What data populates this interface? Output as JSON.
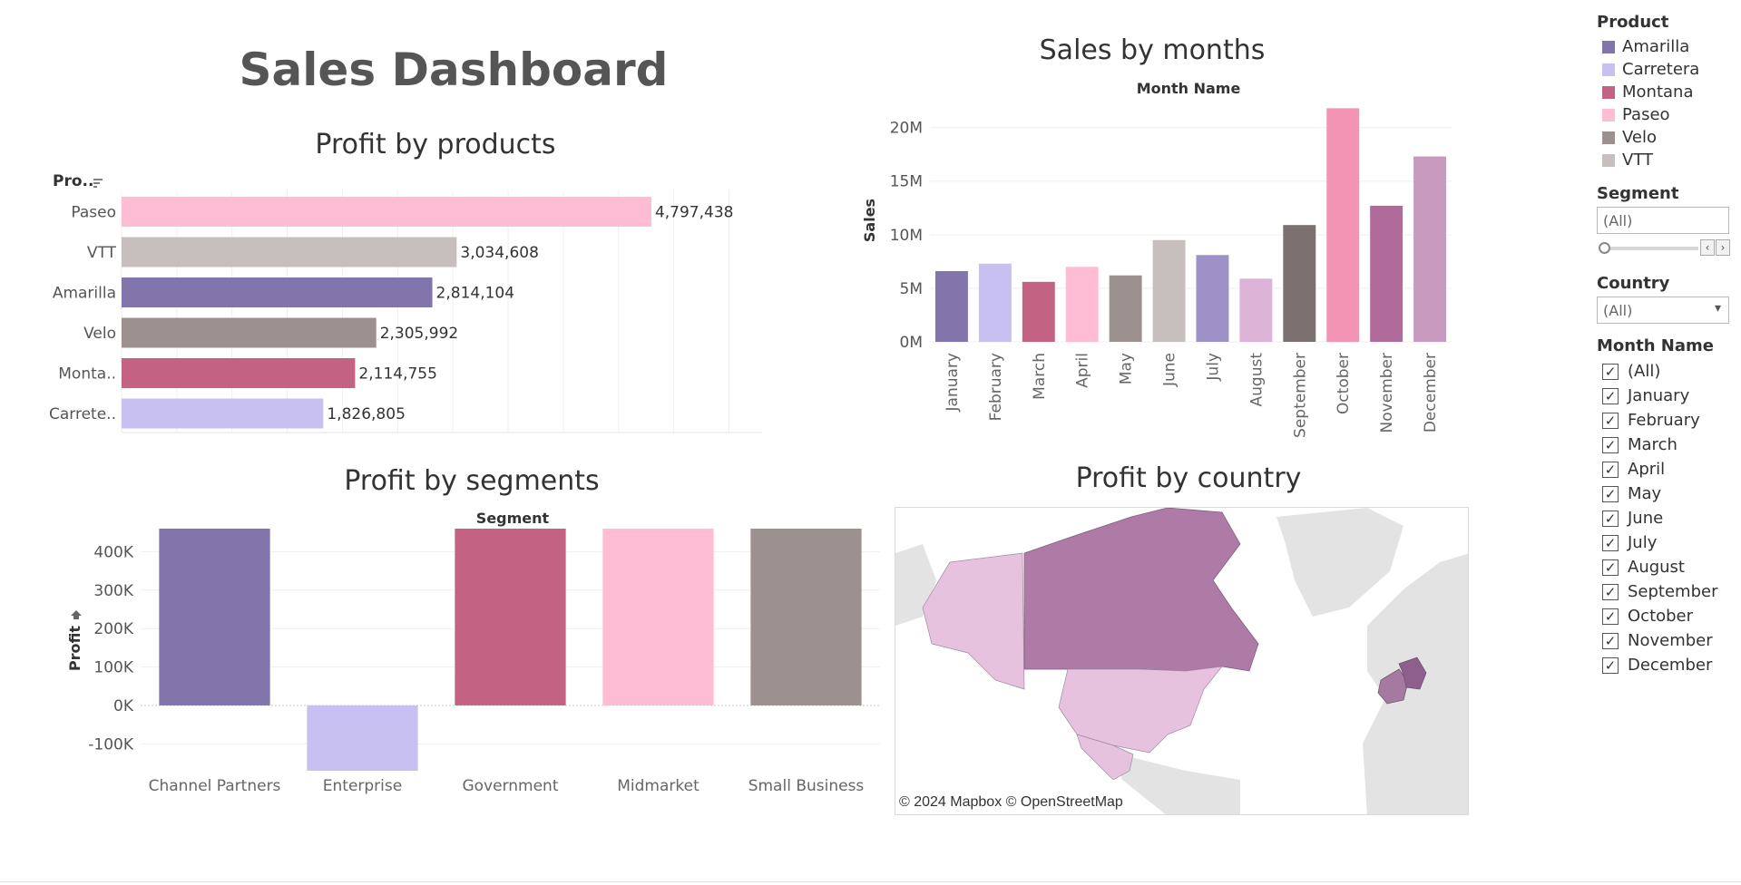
{
  "dashboard": {
    "title": "Sales Dashboard"
  },
  "colors": {
    "Amarilla": "#8175ab",
    "Carretera": "#c8c0f0",
    "Montana": "#c46283",
    "Paseo": "#ffbcd4",
    "Velo": "#9c918f",
    "VTT": "#c6bfbd"
  },
  "chart_data": [
    {
      "id": "profit_by_products",
      "type": "bar",
      "orientation": "horizontal",
      "title": "Profit by products",
      "row_header": "Pro..",
      "categories": [
        "Paseo",
        "VTT",
        "Amarilla",
        "Velo",
        "Monta..",
        "Carrete.."
      ],
      "values": [
        4797438,
        3034608,
        2814104,
        2305992,
        2114755,
        1826805
      ],
      "value_labels": [
        "4,797,438",
        "3,034,608",
        "2,814,104",
        "2,305,992",
        "2,114,755",
        "1,826,805"
      ],
      "colors": [
        "#ffbcd4",
        "#c6bfbd",
        "#8175ab",
        "#9c918f",
        "#c46283",
        "#c8c0f0"
      ],
      "grid": true
    },
    {
      "id": "sales_by_months",
      "type": "bar",
      "title": "Sales by months",
      "column_header": "Month Name",
      "ylabel": "Sales",
      "categories": [
        "January",
        "February",
        "March",
        "April",
        "May",
        "June",
        "July",
        "August",
        "September",
        "October",
        "November",
        "December"
      ],
      "values": [
        6600000,
        7300000,
        5600000,
        7000000,
        6200000,
        9500000,
        8100000,
        5900000,
        10900000,
        21800000,
        12700000,
        17300000
      ],
      "colors": [
        "#8175ab",
        "#c8c0f0",
        "#c46283",
        "#ffbcd4",
        "#9c918f",
        "#c6bfbd",
        "#9d91c8",
        "#ddb4d7",
        "#7d7070",
        "#f494b4",
        "#b06b9b",
        "#c99ac0"
      ],
      "yticks": [
        "0M",
        "5M",
        "10M",
        "15M",
        "20M"
      ],
      "ytick_values": [
        0,
        5000000,
        10000000,
        15000000,
        20000000
      ],
      "ylim": [
        0,
        22000000
      ],
      "grid": true
    },
    {
      "id": "profit_by_segments",
      "type": "bar",
      "title": "Profit by segments",
      "column_header": "Segment",
      "ylabel": "Profit",
      "categories": [
        "Channel Partners",
        "Enterprise",
        "Government",
        "Midmarket",
        "Small Business"
      ],
      "values": [
        460000,
        -170000,
        460000,
        460000,
        460000
      ],
      "colors": [
        "#8175ab",
        "#c8c0f0",
        "#c46283",
        "#ffbcd4",
        "#9c918f"
      ],
      "yticks": [
        "-100K",
        "0K",
        "100K",
        "200K",
        "300K",
        "400K"
      ],
      "ytick_values": [
        -100000,
        0,
        100000,
        200000,
        300000,
        400000
      ],
      "ylim": [
        -170000,
        460000
      ],
      "grid": true
    }
  ],
  "map": {
    "title": "Profit by country",
    "credit": "© 2024 Mapbox © OpenStreetMap",
    "colors": {
      "land": "#e3e3e3",
      "canada": "#ae7aa6",
      "usa": "#e6c2df",
      "mexico": "#e6c2df",
      "alaska": "#e6c2df",
      "germany": "#8e5f8c",
      "france": "#a57aa0"
    }
  },
  "filters": {
    "product": {
      "label": "Product",
      "items": [
        {
          "name": "Amarilla",
          "color": "#8175ab"
        },
        {
          "name": "Carretera",
          "color": "#c8c0f0"
        },
        {
          "name": "Montana",
          "color": "#c46283"
        },
        {
          "name": "Paseo",
          "color": "#ffbcd4"
        },
        {
          "name": "Velo",
          "color": "#9c918f"
        },
        {
          "name": "VTT",
          "color": "#c6bfbd"
        }
      ]
    },
    "segment": {
      "label": "Segment",
      "value": "(All)"
    },
    "country": {
      "label": "Country",
      "value": "(All)"
    },
    "month": {
      "label": "Month Name",
      "items": [
        "(All)",
        "January",
        "February",
        "March",
        "April",
        "May",
        "June",
        "July",
        "August",
        "September",
        "October",
        "November",
        "December"
      ]
    }
  }
}
